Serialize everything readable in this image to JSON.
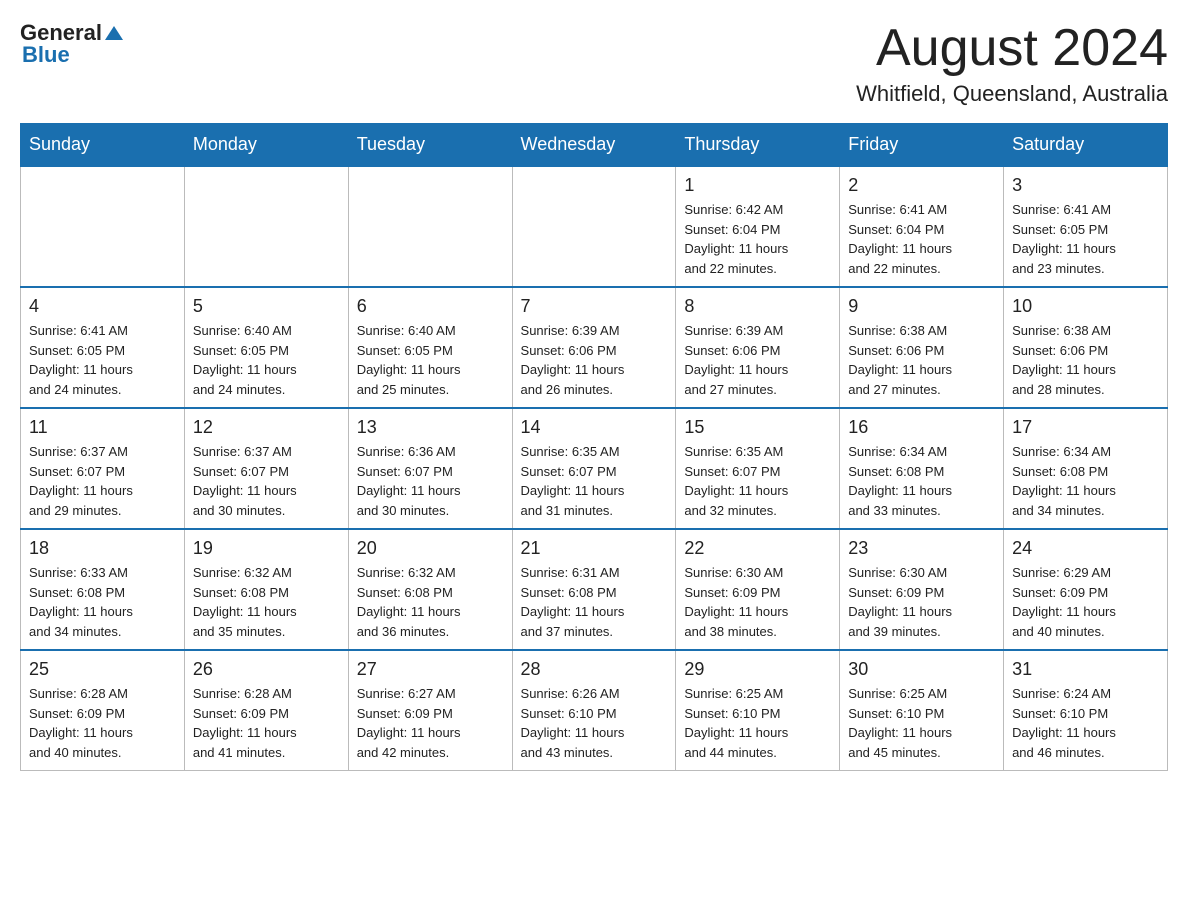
{
  "header": {
    "logo_general": "General",
    "logo_blue": "Blue",
    "month_title": "August 2024",
    "location": "Whitfield, Queensland, Australia"
  },
  "days_of_week": [
    "Sunday",
    "Monday",
    "Tuesday",
    "Wednesday",
    "Thursday",
    "Friday",
    "Saturday"
  ],
  "weeks": [
    [
      {
        "day": "",
        "info": ""
      },
      {
        "day": "",
        "info": ""
      },
      {
        "day": "",
        "info": ""
      },
      {
        "day": "",
        "info": ""
      },
      {
        "day": "1",
        "info": "Sunrise: 6:42 AM\nSunset: 6:04 PM\nDaylight: 11 hours\nand 22 minutes."
      },
      {
        "day": "2",
        "info": "Sunrise: 6:41 AM\nSunset: 6:04 PM\nDaylight: 11 hours\nand 22 minutes."
      },
      {
        "day": "3",
        "info": "Sunrise: 6:41 AM\nSunset: 6:05 PM\nDaylight: 11 hours\nand 23 minutes."
      }
    ],
    [
      {
        "day": "4",
        "info": "Sunrise: 6:41 AM\nSunset: 6:05 PM\nDaylight: 11 hours\nand 24 minutes."
      },
      {
        "day": "5",
        "info": "Sunrise: 6:40 AM\nSunset: 6:05 PM\nDaylight: 11 hours\nand 24 minutes."
      },
      {
        "day": "6",
        "info": "Sunrise: 6:40 AM\nSunset: 6:05 PM\nDaylight: 11 hours\nand 25 minutes."
      },
      {
        "day": "7",
        "info": "Sunrise: 6:39 AM\nSunset: 6:06 PM\nDaylight: 11 hours\nand 26 minutes."
      },
      {
        "day": "8",
        "info": "Sunrise: 6:39 AM\nSunset: 6:06 PM\nDaylight: 11 hours\nand 27 minutes."
      },
      {
        "day": "9",
        "info": "Sunrise: 6:38 AM\nSunset: 6:06 PM\nDaylight: 11 hours\nand 27 minutes."
      },
      {
        "day": "10",
        "info": "Sunrise: 6:38 AM\nSunset: 6:06 PM\nDaylight: 11 hours\nand 28 minutes."
      }
    ],
    [
      {
        "day": "11",
        "info": "Sunrise: 6:37 AM\nSunset: 6:07 PM\nDaylight: 11 hours\nand 29 minutes."
      },
      {
        "day": "12",
        "info": "Sunrise: 6:37 AM\nSunset: 6:07 PM\nDaylight: 11 hours\nand 30 minutes."
      },
      {
        "day": "13",
        "info": "Sunrise: 6:36 AM\nSunset: 6:07 PM\nDaylight: 11 hours\nand 30 minutes."
      },
      {
        "day": "14",
        "info": "Sunrise: 6:35 AM\nSunset: 6:07 PM\nDaylight: 11 hours\nand 31 minutes."
      },
      {
        "day": "15",
        "info": "Sunrise: 6:35 AM\nSunset: 6:07 PM\nDaylight: 11 hours\nand 32 minutes."
      },
      {
        "day": "16",
        "info": "Sunrise: 6:34 AM\nSunset: 6:08 PM\nDaylight: 11 hours\nand 33 minutes."
      },
      {
        "day": "17",
        "info": "Sunrise: 6:34 AM\nSunset: 6:08 PM\nDaylight: 11 hours\nand 34 minutes."
      }
    ],
    [
      {
        "day": "18",
        "info": "Sunrise: 6:33 AM\nSunset: 6:08 PM\nDaylight: 11 hours\nand 34 minutes."
      },
      {
        "day": "19",
        "info": "Sunrise: 6:32 AM\nSunset: 6:08 PM\nDaylight: 11 hours\nand 35 minutes."
      },
      {
        "day": "20",
        "info": "Sunrise: 6:32 AM\nSunset: 6:08 PM\nDaylight: 11 hours\nand 36 minutes."
      },
      {
        "day": "21",
        "info": "Sunrise: 6:31 AM\nSunset: 6:08 PM\nDaylight: 11 hours\nand 37 minutes."
      },
      {
        "day": "22",
        "info": "Sunrise: 6:30 AM\nSunset: 6:09 PM\nDaylight: 11 hours\nand 38 minutes."
      },
      {
        "day": "23",
        "info": "Sunrise: 6:30 AM\nSunset: 6:09 PM\nDaylight: 11 hours\nand 39 minutes."
      },
      {
        "day": "24",
        "info": "Sunrise: 6:29 AM\nSunset: 6:09 PM\nDaylight: 11 hours\nand 40 minutes."
      }
    ],
    [
      {
        "day": "25",
        "info": "Sunrise: 6:28 AM\nSunset: 6:09 PM\nDaylight: 11 hours\nand 40 minutes."
      },
      {
        "day": "26",
        "info": "Sunrise: 6:28 AM\nSunset: 6:09 PM\nDaylight: 11 hours\nand 41 minutes."
      },
      {
        "day": "27",
        "info": "Sunrise: 6:27 AM\nSunset: 6:09 PM\nDaylight: 11 hours\nand 42 minutes."
      },
      {
        "day": "28",
        "info": "Sunrise: 6:26 AM\nSunset: 6:10 PM\nDaylight: 11 hours\nand 43 minutes."
      },
      {
        "day": "29",
        "info": "Sunrise: 6:25 AM\nSunset: 6:10 PM\nDaylight: 11 hours\nand 44 minutes."
      },
      {
        "day": "30",
        "info": "Sunrise: 6:25 AM\nSunset: 6:10 PM\nDaylight: 11 hours\nand 45 minutes."
      },
      {
        "day": "31",
        "info": "Sunrise: 6:24 AM\nSunset: 6:10 PM\nDaylight: 11 hours\nand 46 minutes."
      }
    ]
  ]
}
